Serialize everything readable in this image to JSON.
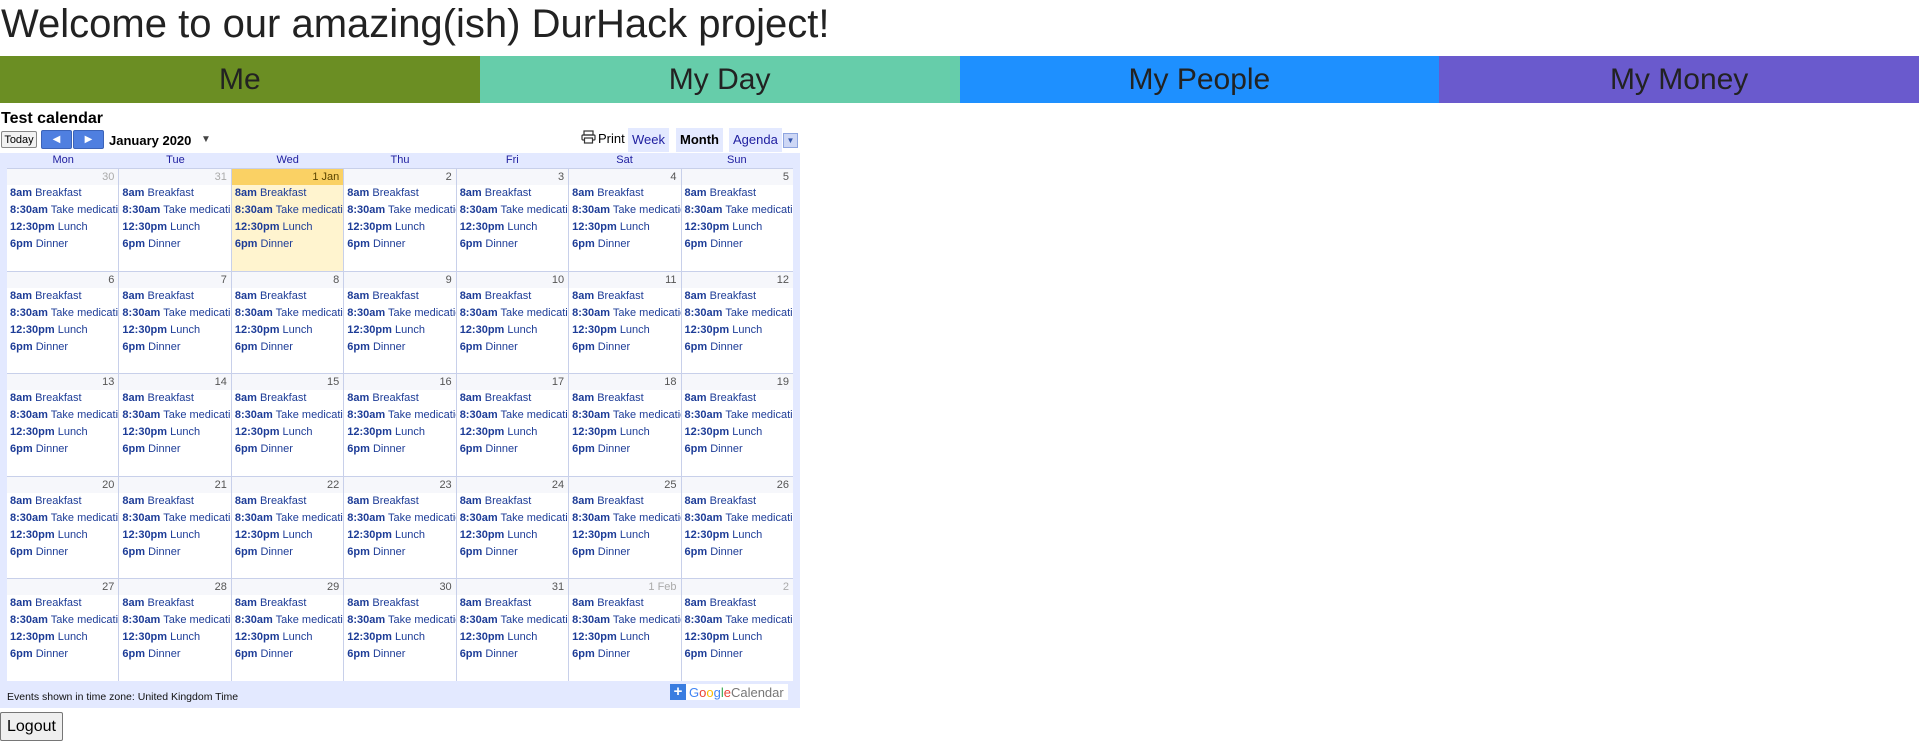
{
  "page": {
    "title": "Welcome to our amazing(ish) DurHack project!"
  },
  "nav": [
    {
      "label": "Me",
      "color": "#6b8e23"
    },
    {
      "label": "My Day",
      "color": "#66cdaa"
    },
    {
      "label": "My People",
      "color": "#1e90ff"
    },
    {
      "label": "My Money",
      "color": "#6a5acd"
    }
  ],
  "calendar": {
    "title": "Test calendar",
    "today_label": "Today",
    "month_label": "January 2020",
    "print_label": "Print",
    "views": [
      "Week",
      "Month",
      "Agenda"
    ],
    "active_view": "Month",
    "weekdays": [
      "Mon",
      "Tue",
      "Wed",
      "Thu",
      "Fri",
      "Sat",
      "Sun"
    ],
    "weeks": [
      [
        {
          "n": "30",
          "other": true
        },
        {
          "n": "31",
          "other": true
        },
        {
          "n": "1 Jan",
          "today": true
        },
        {
          "n": "2"
        },
        {
          "n": "3"
        },
        {
          "n": "4"
        },
        {
          "n": "5"
        }
      ],
      [
        {
          "n": "6"
        },
        {
          "n": "7"
        },
        {
          "n": "8"
        },
        {
          "n": "9"
        },
        {
          "n": "10"
        },
        {
          "n": "11"
        },
        {
          "n": "12"
        }
      ],
      [
        {
          "n": "13"
        },
        {
          "n": "14"
        },
        {
          "n": "15"
        },
        {
          "n": "16"
        },
        {
          "n": "17"
        },
        {
          "n": "18"
        },
        {
          "n": "19"
        }
      ],
      [
        {
          "n": "20"
        },
        {
          "n": "21"
        },
        {
          "n": "22"
        },
        {
          "n": "23"
        },
        {
          "n": "24"
        },
        {
          "n": "25"
        },
        {
          "n": "26"
        }
      ],
      [
        {
          "n": "27"
        },
        {
          "n": "28"
        },
        {
          "n": "29"
        },
        {
          "n": "30"
        },
        {
          "n": "31"
        },
        {
          "n": "1 Feb",
          "other": true
        },
        {
          "n": "2",
          "other": true
        }
      ]
    ],
    "events": [
      {
        "time": "8am",
        "title": "Breakfast"
      },
      {
        "time": "8:30am",
        "title": "Take medication"
      },
      {
        "time": "12:30pm",
        "title": "Lunch"
      },
      {
        "time": "6pm",
        "title": "Dinner"
      }
    ],
    "timezone_note": "Events shown in time zone: United Kingdom Time",
    "badge_text": "Calendar",
    "badge_google": [
      "G",
      "o",
      "o",
      "g",
      "l",
      "e"
    ]
  },
  "logout_label": "Logout"
}
